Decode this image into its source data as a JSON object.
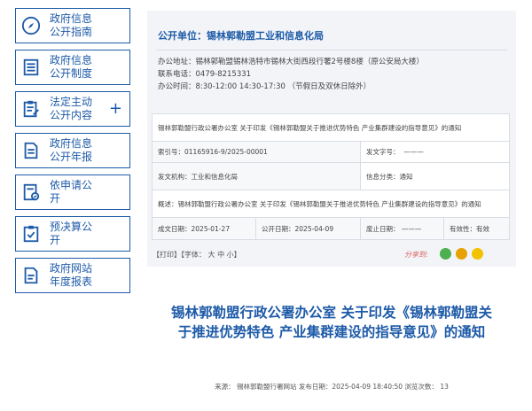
{
  "sidebar": {
    "items": [
      {
        "icon": "compass-icon",
        "line1": "政府信息",
        "line2": "公开指南"
      },
      {
        "icon": "list-document-icon",
        "line1": "政府信息",
        "line2": "公开制度"
      },
      {
        "icon": "clipboard-edit-icon",
        "line1": "法定主动",
        "line2": "公开内容",
        "plus": "+"
      },
      {
        "icon": "report-document-icon",
        "line1": "政府信息",
        "line2": "公开年报"
      },
      {
        "icon": "application-form-icon",
        "line1": "依申请公",
        "line2": "开"
      },
      {
        "icon": "budget-check-icon",
        "line1": "预决算公",
        "line2": "开"
      },
      {
        "icon": "annual-report-icon",
        "line1": "政府网站",
        "line2": "年度报表"
      }
    ]
  },
  "unit": {
    "title": "公开单位：锡林郭勒盟工业和信息化局",
    "address": "办公地址：锡林郭勒盟锡林浩特市锡林大街西段行署2号楼8楼（原公安局大楼）",
    "phone": "联系电话：0479-8215331",
    "hours": "办公时间：8:30-12:00 14:30-17:30 （节假日及双休日除外）"
  },
  "info": {
    "doc_title": "锡林郭勒盟行政公署办公室 关于印发《锡林郭勒盟关于推进优势特色 产业集群建设的指导意见》的通知",
    "index_label": "索引号：",
    "index_value": "01165916-9/2025-00001",
    "docno_label": "发文字号：",
    "docno_value": "———",
    "issuer_label": "发文机构：",
    "issuer_value": "工业和信息化局",
    "category_label": "信息分类：",
    "category_value": "通知",
    "summary": "概述：锡林郭勒盟行政公署办公室 关于印发《锡林郭勒盟关于推进优势特色 产业集群建设的指导意见》的通知",
    "created_label": "成文日期：",
    "created_value": "2025-01-27",
    "published_label": "公开日期：",
    "published_value": "2025-04-09",
    "abolished_label": "废止日期：",
    "abolished_value": "———",
    "validity_label": "有效性：",
    "validity_value": "有效"
  },
  "tools": {
    "text": "【打印】【字体： 大  中  小】",
    "share_label": "分享到:"
  },
  "article": {
    "title": "锡林郭勒盟行政公署办公室 关于印发《锡林郭勒盟关于推进优势特色 产业集群建设的指导意见》的通知",
    "meta": "来源：  锡林郭勒盟行署网站      发布日期：2025-04-09 18:40:50  浏览次数： 13"
  },
  "colors": {
    "accent": "#1d5aa8",
    "wechat": "#4caf50",
    "weibo": "#e7a100",
    "other": "#f2c200"
  }
}
